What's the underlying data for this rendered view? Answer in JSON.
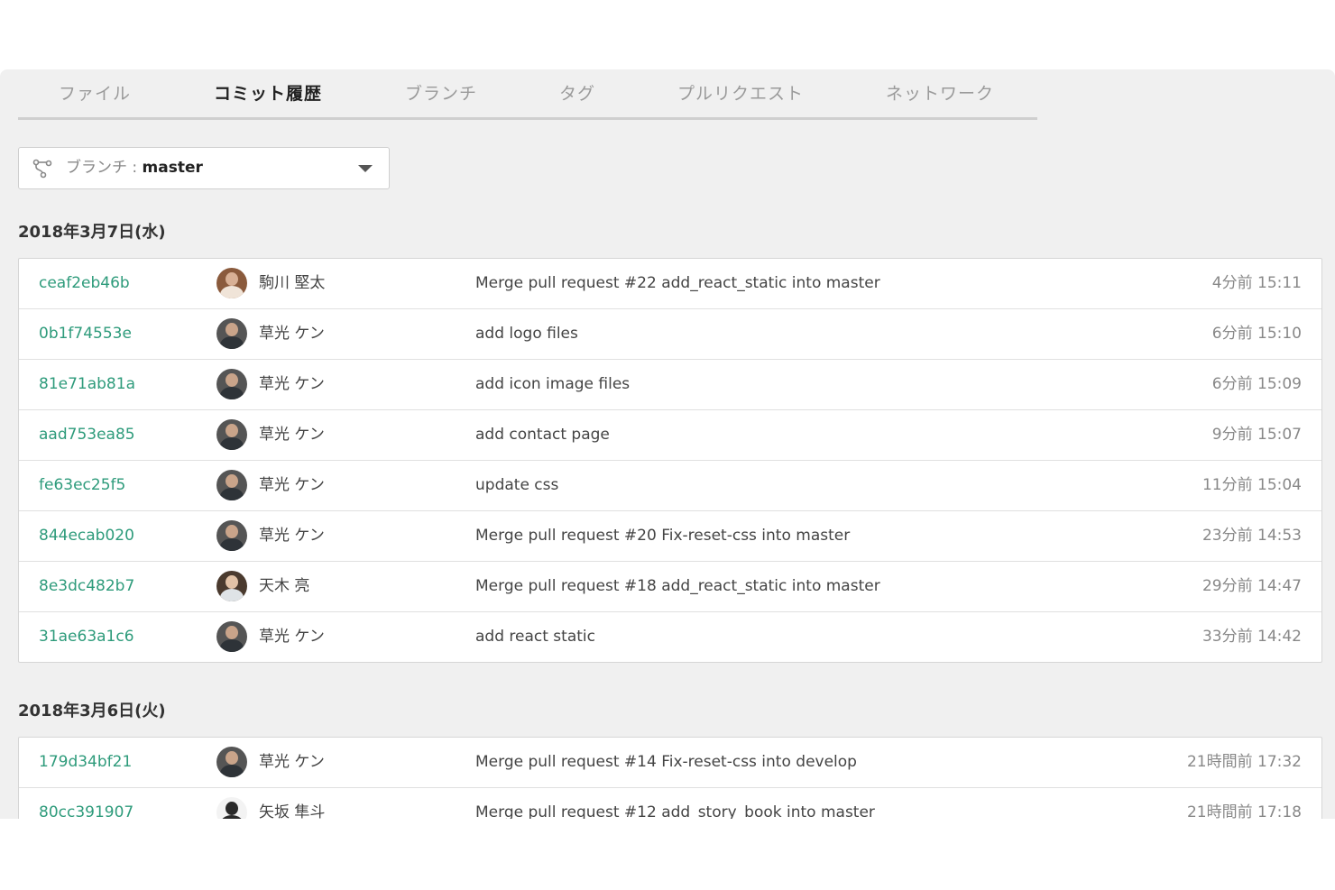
{
  "tabs": [
    {
      "label": "ファイル"
    },
    {
      "label": "コミット履歴"
    },
    {
      "label": "ブランチ"
    },
    {
      "label": "タグ"
    },
    {
      "label": "プルリクエスト"
    },
    {
      "label": "ネットワーク"
    }
  ],
  "active_tab": "コミット履歴",
  "branch_selector": {
    "prefix": "ブランチ : ",
    "value": "master",
    "icon": "branch-icon"
  },
  "colors": {
    "accent": "#2e9b7b",
    "panel_bg": "#f0f0f0"
  },
  "groups": [
    {
      "date": "2018年3月7日(水)",
      "commits": [
        {
          "hash": "ceaf2eb46b",
          "author": "駒川 堅太",
          "avatar": "avatar-brown",
          "message": "Merge pull request #22 add_react_static into master",
          "time": "4分前 15:11"
        },
        {
          "hash": "0b1f74553e",
          "author": "草光 ケン",
          "avatar": "avatar-dark",
          "message": "add logo files",
          "time": "6分前 15:10"
        },
        {
          "hash": "81e71ab81a",
          "author": "草光 ケン",
          "avatar": "avatar-dark",
          "message": "add icon image files",
          "time": "6分前 15:09"
        },
        {
          "hash": "aad753ea85",
          "author": "草光 ケン",
          "avatar": "avatar-dark",
          "message": "add contact page",
          "time": "9分前 15:07"
        },
        {
          "hash": "fe63ec25f5",
          "author": "草光 ケン",
          "avatar": "avatar-dark",
          "message": "update css",
          "time": "11分前 15:04"
        },
        {
          "hash": "844ecab020",
          "author": "草光 ケン",
          "avatar": "avatar-dark",
          "message": "Merge pull request #20 Fix-reset-css into master",
          "time": "23分前 14:53"
        },
        {
          "hash": "8e3dc482b7",
          "author": "天木 亮",
          "avatar": "avatar-light",
          "message": "Merge pull request #18 add_react_static into master",
          "time": "29分前 14:47"
        },
        {
          "hash": "31ae63a1c6",
          "author": "草光 ケン",
          "avatar": "avatar-dark",
          "message": "add react static",
          "time": "33分前 14:42"
        }
      ]
    },
    {
      "date": "2018年3月6日(火)",
      "commits": [
        {
          "hash": "179d34bf21",
          "author": "草光 ケン",
          "avatar": "avatar-dark",
          "message": "Merge pull request #14 Fix-reset-css into develop",
          "time": "21時間前 17:32"
        },
        {
          "hash": "80cc391907",
          "author": "矢坂 隼斗",
          "avatar": "avatar-dark",
          "message": "Merge pull request #12 add_story_book into master",
          "time": "21時間前 17:18"
        }
      ]
    }
  ]
}
